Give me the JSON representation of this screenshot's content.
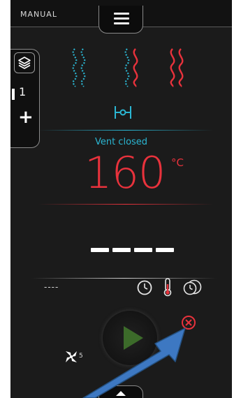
{
  "header": {
    "mode": "MANUAL"
  },
  "side_panel": {
    "rack_number": "1",
    "add_symbol": "+"
  },
  "vent": {
    "status": "Vent closed"
  },
  "temperature": {
    "value": "160",
    "unit": "°C"
  },
  "timer": {
    "secondary": "----"
  },
  "fan": {
    "speed": "5"
  },
  "colors": {
    "humidity_blue": "#2bb6d2",
    "heat_red": "#e8323c",
    "play_green": "#3c6b2a",
    "arrow_blue": "#3d78c2"
  },
  "icons": {
    "menu": "menu-icon",
    "layers": "layers-icon",
    "steam": "steam-wave-icon",
    "vent": "vent-icon",
    "clock": "clock-icon",
    "thermometer": "thermometer-icon",
    "multi_timer": "multi-timer-icon",
    "play": "play-icon",
    "cancel": "cancel-icon",
    "fan": "fan-icon",
    "arrow": "pointer-arrow-icon"
  }
}
